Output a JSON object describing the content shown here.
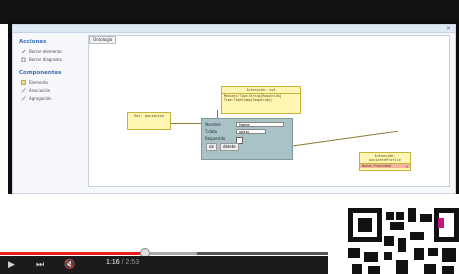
{
  "sidebar": {
    "sections": [
      {
        "title": "Acciones",
        "items": [
          {
            "label": "Borrar elemento",
            "icon": "pencil-icon"
          },
          {
            "label": "Borrar diagrama",
            "icon": "trash-icon"
          }
        ]
      },
      {
        "title": "Componentes",
        "items": [
          {
            "label": "Elemento",
            "icon": "box-icon"
          },
          {
            "label": "Asociación",
            "icon": "association-icon"
          },
          {
            "label": "Agregación",
            "icon": "aggregation-icon"
          }
        ]
      }
    ]
  },
  "canvas": {
    "tab_label": "Ontología"
  },
  "uml": {
    "box1": {
      "header": "Intención: evt",
      "attrs": [
        "Mensaje:Tipo:String[Requerido]",
        "Time:TimeStamp[Requerido]"
      ]
    },
    "box2": {
      "header": "Rol: pacienteA"
    },
    "box3": {
      "header": "Intención: pacienteProfile"
    },
    "box3_field": "Nuevo Propiedad"
  },
  "dialog": {
    "nombre_label": "Nombre",
    "nombre_value": "Name",
    "tipo_label": "T.dato",
    "tipo_value": "string",
    "requerido_label": "Requerido",
    "ok_label": "ok",
    "delete_label": "delete"
  },
  "player": {
    "current_time": "1:16",
    "separator": " / ",
    "total_time": "2:53",
    "progress_fraction": 0.44,
    "buffer_fraction": 0.6
  },
  "colors": {
    "progress": "#e62117",
    "accent": "#3b6db6"
  }
}
